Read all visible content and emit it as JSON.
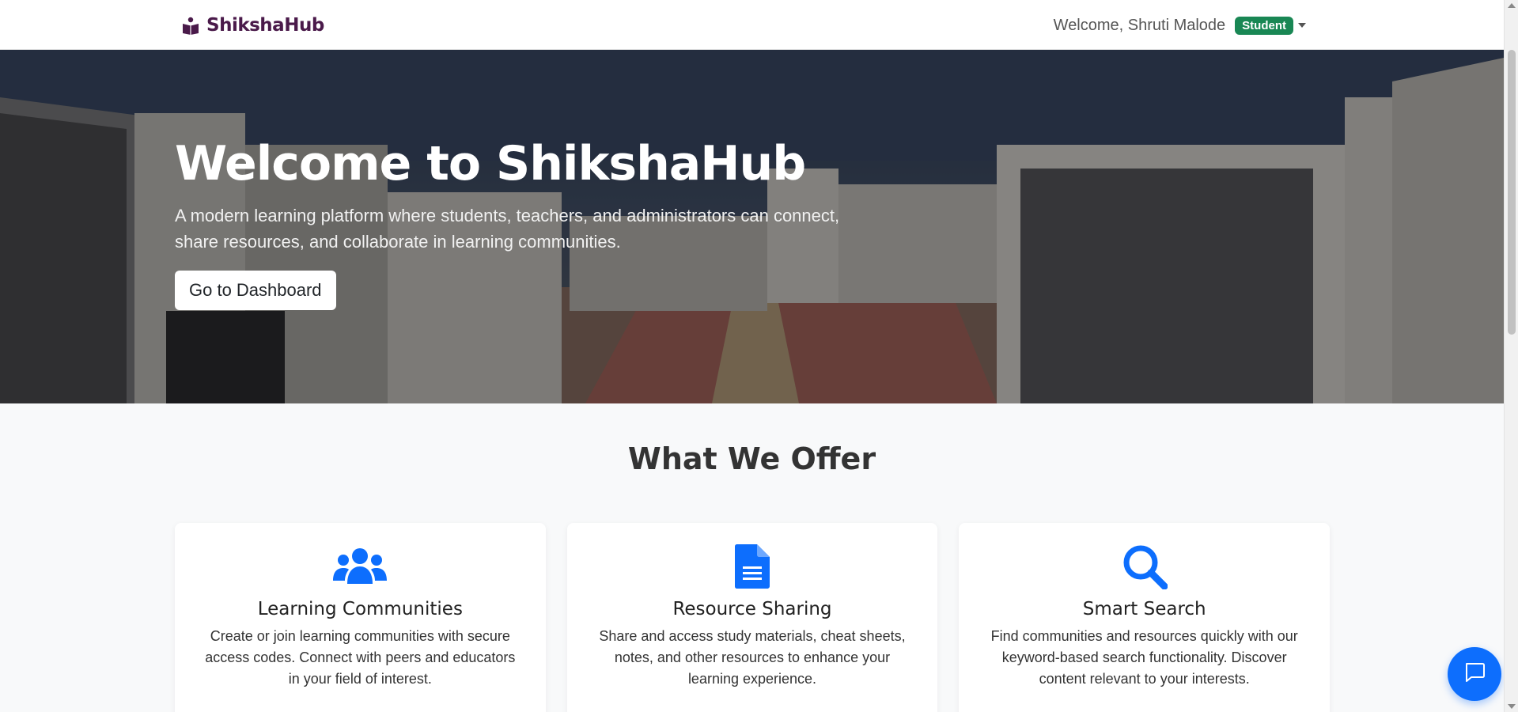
{
  "nav": {
    "brand": "ShikshaHub",
    "brand_icon": "book-reader-icon",
    "welcome": "Welcome, Shruti Malode",
    "role": "Student"
  },
  "hero": {
    "title": "Welcome to ShikshaHub",
    "subtitle": "A modern learning platform where students, teachers, and administrators can connect, share resources, and collaborate in learning communities.",
    "button": "Go to Dashboard"
  },
  "offers": {
    "title": "What We Offer",
    "cards": [
      {
        "icon": "users-icon",
        "title": "Learning Communities",
        "text": "Create or join learning communities with secure access codes. Connect with peers and educators in your field of interest."
      },
      {
        "icon": "file-text-icon",
        "title": "Resource Sharing",
        "text": "Share and access study materials, cheat sheets, notes, and other resources to enhance your learning experience."
      },
      {
        "icon": "search-icon",
        "title": "Smart Search",
        "text": "Find communities and resources quickly with our keyword-based search functionality. Discover content relevant to your interests."
      }
    ]
  },
  "colors": {
    "brand": "#4a1a4a",
    "accent": "#0d6efd",
    "badge": "#198754"
  },
  "chat": {
    "icon": "chat-icon"
  }
}
